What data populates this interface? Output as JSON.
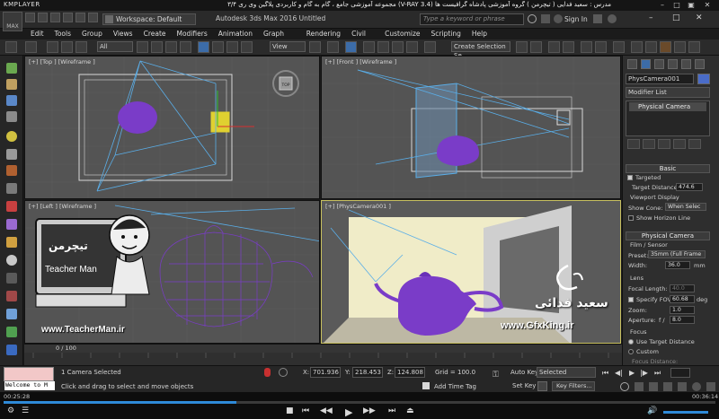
{
  "player": {
    "logo": "KMPLAYER",
    "title": "مجموعه آموزشی جامع ، گام به گام و کاربردی پلاگین وی ری ۳/۴ (V-RAY 3.4) مدرس : سعید فدایی ( تیچرمن ) گروه آموزشی پادشاه گرافیست ها"
  },
  "max": {
    "logo_text": "MAX",
    "workspace": "Workspace: Default",
    "title": "Autodesk 3ds Max 2016    Untitled",
    "search_placeholder": "Type a keyword or phrase",
    "signin": "Sign In"
  },
  "menu": [
    "Edit",
    "Tools",
    "Group",
    "Views",
    "Create",
    "Modifiers",
    "Animation",
    "Graph Editors",
    "Rendering",
    "Civil View",
    "Customize",
    "Scripting",
    "Help"
  ],
  "toolbar": {
    "filter": "All",
    "ref_coord": "View",
    "selection_set": "Create Selection Se"
  },
  "viewports": {
    "top": "[+] [Top ] [Wireframe ]",
    "front": "[+] [Front ] [Wireframe ]",
    "left": "[+] [Left ] [Wireframe ]",
    "persp": "[+] [PhysCamera001 ]",
    "cube_label": "TOP"
  },
  "command_panel": {
    "object_name": "PhysCamera001",
    "modifier_list": "Modifier List",
    "stack_item": "Physical Camera",
    "basic": {
      "header": "Basic",
      "targeted": "Targeted",
      "target_distance_label": "Target Distance:",
      "target_distance": "474.6",
      "viewport_display": "Viewport Display",
      "show_cone_label": "Show Cone:",
      "show_cone": "When Selec",
      "show_horizon": "Show Horizon Line"
    },
    "physical": {
      "header": "Physical Camera",
      "film_sensor": "Film / Sensor",
      "preset_label": "Preset:",
      "preset": "35mm (Full Frame",
      "width_label": "Width:",
      "width": "36.0",
      "width_unit": "mm",
      "lens": "Lens",
      "focal_label": "Focal Length:",
      "focal": "40.0",
      "fov_label": "Specify FOV:",
      "fov": "60.68",
      "fov_unit": "deg",
      "zoom_label": "Zoom:",
      "zoom": "1.0",
      "aperture_label": "Aperture:",
      "aperture_prefix": "f /",
      "aperture": "8.0",
      "focus": "Focus",
      "use_target": "Use Target Distance",
      "custom": "Custom",
      "focus_distance": "Focus Distance:"
    }
  },
  "timeline": {
    "frame": "0 / 100"
  },
  "status": {
    "maxscript": "Welcome to M",
    "line1": "1 Camera Selected",
    "line2": "Click and drag to select and move objects",
    "x_label": "X:",
    "x": "701.936",
    "y_label": "Y:",
    "y": "218.453",
    "z_label": "Z:",
    "z": "124.808",
    "grid": "Grid = 100.0",
    "add_time_tag": "Add Time Tag",
    "auto_key": "Auto Key",
    "set_key": "Set Key",
    "selected": "Selected",
    "key_filters": "Key Filters..."
  },
  "video": {
    "current": "00:25:28",
    "total": "00:36:14",
    "progress": 0.327
  },
  "watermarks": {
    "teacherman_url": "www.TeacherMan.ir",
    "gfxking_url": "www.GfxKing.ir",
    "gfxking_name": "سعید فدائی",
    "teacherman_name": "Teacher Man"
  },
  "colors": {
    "teapot": "#7a3cc8",
    "camera_line": "#5aaee8",
    "accent": "#2e8ad8"
  }
}
